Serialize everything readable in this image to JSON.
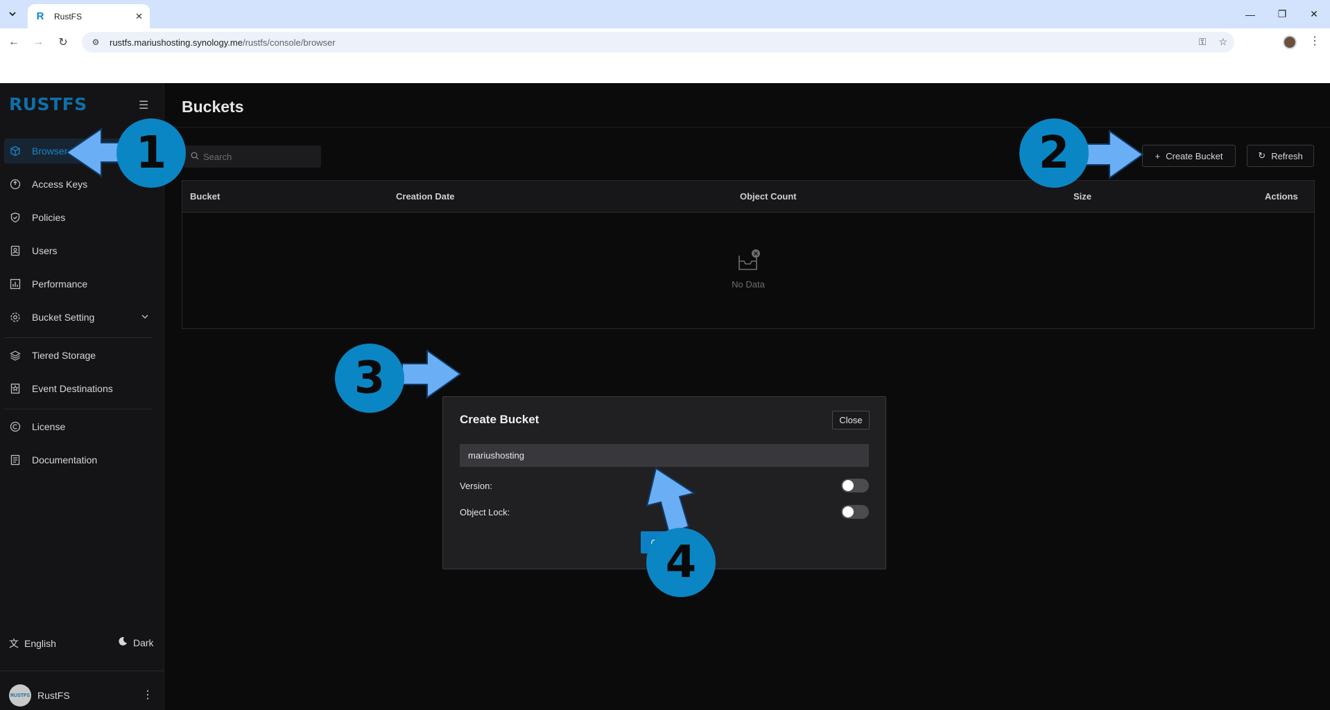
{
  "browser": {
    "tab_title": "RustFS",
    "tab_favicon": "R",
    "url_host": "rustfs.mariushosting.synology.me",
    "url_path": "/rustfs/console/browser"
  },
  "sidebar": {
    "logo": "RUSTFS",
    "items": [
      {
        "label": "Browser",
        "icon": "cube-icon",
        "active": true
      },
      {
        "label": "Access Keys",
        "icon": "key-circle-icon"
      },
      {
        "label": "Policies",
        "icon": "shield-check-icon"
      },
      {
        "label": "Users",
        "icon": "user-card-icon"
      },
      {
        "label": "Performance",
        "icon": "bar-chart-icon"
      },
      {
        "label": "Bucket Setting",
        "icon": "gear-icon"
      },
      {
        "label": "Tiered Storage",
        "icon": "layers-icon"
      },
      {
        "label": "Event Destinations",
        "icon": "bookmark-icon"
      },
      {
        "label": "License",
        "icon": "copyright-icon"
      },
      {
        "label": "Documentation",
        "icon": "document-icon"
      }
    ],
    "language": "English",
    "theme": "Dark",
    "user_name": "RustFS",
    "avatar_text": "RUSTFS"
  },
  "main": {
    "title": "Buckets",
    "search_placeholder": "Search",
    "create_label": "Create Bucket",
    "refresh_label": "Refresh",
    "columns": [
      "Bucket",
      "Creation Date",
      "Object Count",
      "Size",
      "Actions"
    ],
    "empty_text": "No Data"
  },
  "modal": {
    "title": "Create Bucket",
    "close_label": "Close",
    "bucket_name": "mariushosting",
    "version_label": "Version:",
    "version_enabled": false,
    "object_lock_label": "Object Lock:",
    "object_lock_enabled": false,
    "create_label": "Create"
  },
  "annotations": {
    "step1": "1",
    "step2": "2",
    "step3": "3",
    "step4": "4",
    "color": "#0b86c4",
    "arrow_color": "#6aaef5"
  }
}
